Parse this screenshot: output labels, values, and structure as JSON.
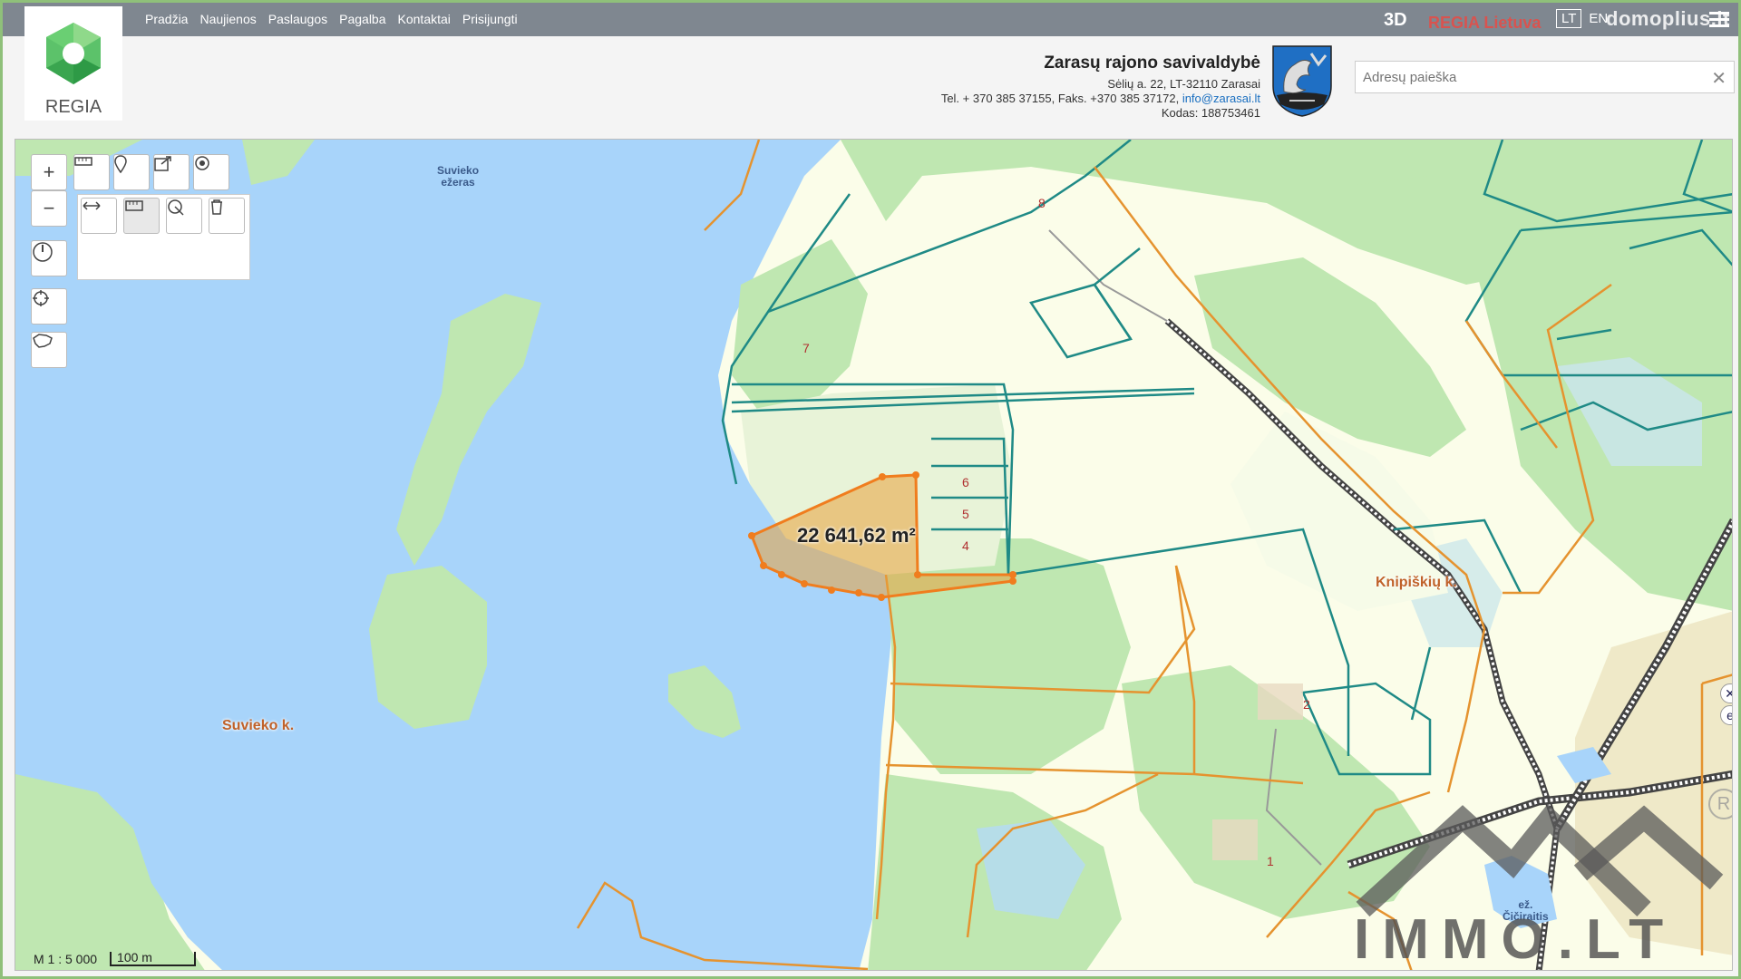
{
  "nav": {
    "logo_text": "REGIA",
    "items": [
      "Pradžia",
      "Naujienos",
      "Paslaugos",
      "Pagalba",
      "Kontaktai",
      "Prisijungti"
    ],
    "btn_3d": "3D",
    "regia_lietuva": "REGIA Lietuva",
    "lang_active": "LT",
    "lang_en": "EN",
    "watermark": "domoplius.lt"
  },
  "header": {
    "title": "Zarasų rajono savivaldybė",
    "address": "Sėlių a. 22, LT-32110 Zarasai",
    "phone": "Tel. + 370 385 37155, Faks. +370 385 37172,",
    "email": "info@zarasai.lt",
    "code": "Kodas: 188753461"
  },
  "search": {
    "placeholder": "Adresų paieška",
    "clear": "✕"
  },
  "map": {
    "area_label": "22 641,62 m²",
    "places": {
      "suvieko_k": "Suvieko k.",
      "knipiskiu_k": "Knipiškių k.",
      "lake_line1": "Suvieko",
      "lake_line2": "ežeras",
      "ciciraitis_line1": "ež.",
      "ciciraitis_line2": "Čičiraitis"
    },
    "parcels": [
      "1",
      "2",
      "4",
      "5",
      "6",
      "7",
      "8"
    ],
    "scale_ratio": "M 1 : 5 000",
    "scale_bar": "100 m",
    "colors": {
      "water": "#a8d4fa",
      "forest": "#bfe7b1",
      "field": "#fbfde9",
      "parcel_border": "#1f8a86",
      "boundary": "#e5932f",
      "selection": "#f07d1e"
    }
  },
  "watermark_bottom": "IMMO.LT",
  "reg_mark": "R"
}
